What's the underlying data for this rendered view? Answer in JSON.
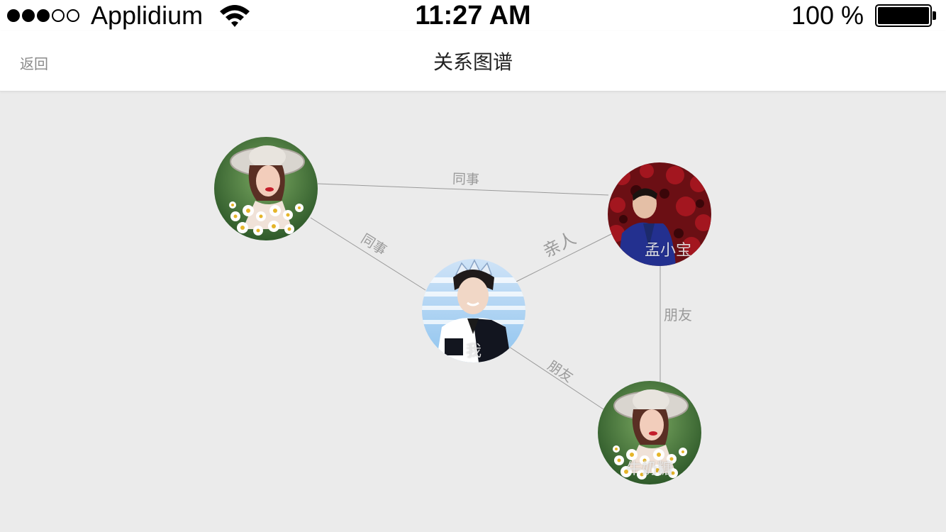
{
  "status_bar": {
    "carrier": "Applidium",
    "time": "11:27 AM",
    "battery": "100 %"
  },
  "nav": {
    "back_label": "返回",
    "title": "关系图谱"
  },
  "graph": {
    "nodes": {
      "me": {
        "name": "我"
      },
      "meng": {
        "name": "孟小宝"
      },
      "topleft": {
        "name": ""
      },
      "bottom": {
        "name": "牛奶糖"
      }
    },
    "edges": {
      "topleft_meng": "同事",
      "topleft_me": "同事",
      "me_meng": "亲人",
      "meng_bottom": "朋友",
      "me_bottom": "朋友"
    }
  },
  "colors": {
    "background": "#ebebeb",
    "edge": "#9a9a9a",
    "nav_text": "#8a8a8a"
  }
}
